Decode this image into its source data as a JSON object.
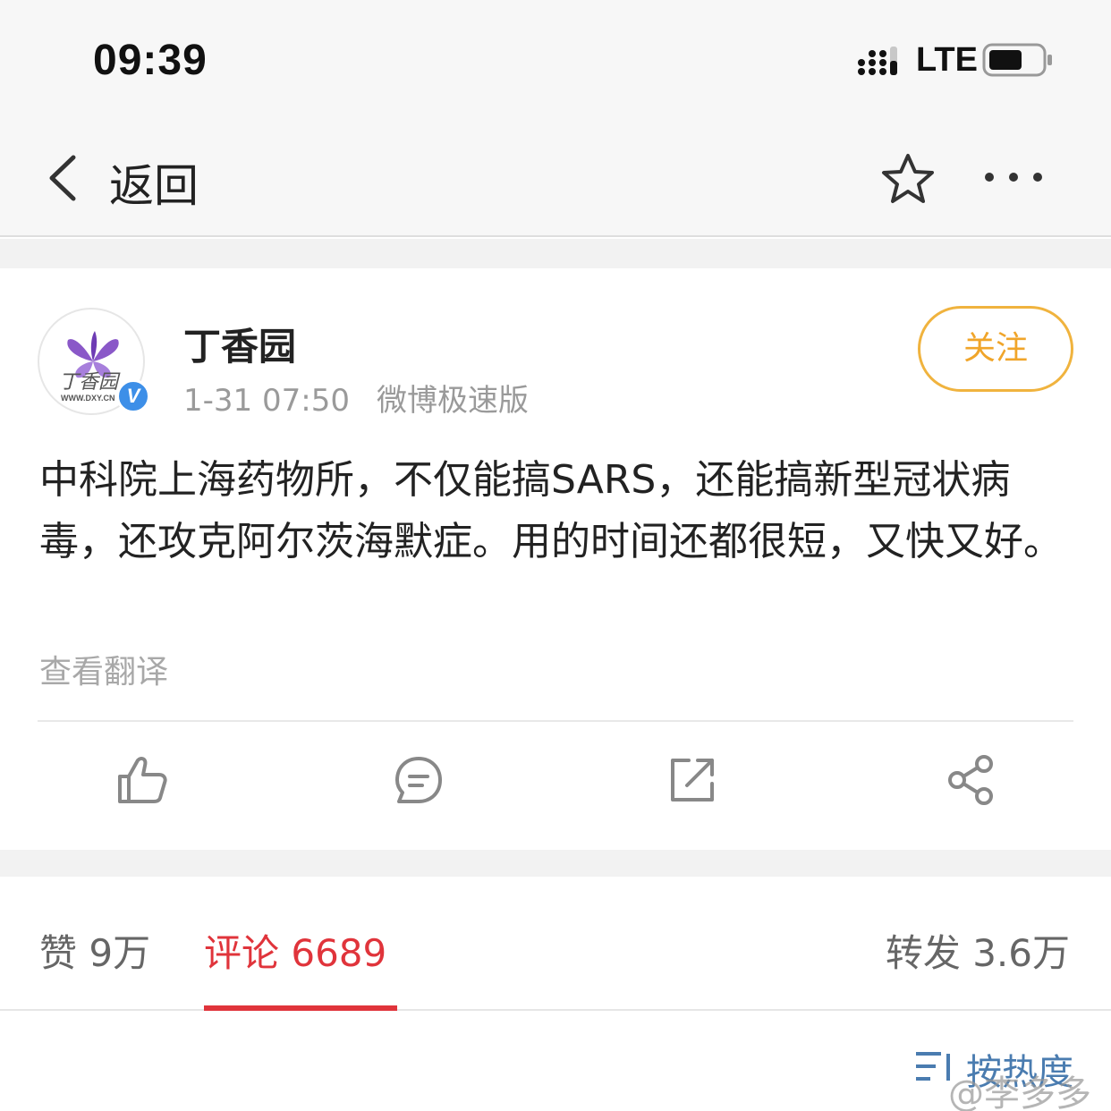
{
  "status_bar": {
    "time": "09:39",
    "network": "LTE",
    "signal_icon": "cellular-signal-icon",
    "battery_icon": "battery-icon"
  },
  "nav": {
    "back_label": "返回",
    "back_icon": "chevron-left-icon",
    "favorite_icon": "star-icon",
    "more_icon": "more-horizontal-icon"
  },
  "post": {
    "author": "丁香园",
    "avatar_text": "丁香园",
    "avatar_url_text": "WWW.DXY.CN",
    "verified_mark": "V",
    "timestamp": "1-31 07:50",
    "source": "微博极速版",
    "follow_label": "关注",
    "text": "中科院上海药物所，不仅能搞SARS，还能搞新型冠状病毒，还攻克阿尔茨海默症。用的时间还都很短，又快又好。",
    "translate_label": "查看翻译",
    "actions": [
      {
        "name": "like",
        "icon": "thumbs-up-icon"
      },
      {
        "name": "comment",
        "icon": "comment-bubble-icon"
      },
      {
        "name": "repost",
        "icon": "repost-arrow-icon"
      },
      {
        "name": "share",
        "icon": "share-nodes-icon"
      }
    ]
  },
  "tabs": {
    "likes": "赞 9万",
    "comments": "评论 6689",
    "reposts": "转发 3.6万",
    "active": "comments"
  },
  "sort": {
    "label": "按热度",
    "icon": "sort-icon"
  },
  "watermark": "@李多多",
  "colors": {
    "accent_red": "#e0343b",
    "follow_orange": "#f0a52a",
    "verified_blue": "#3d8fe8",
    "link_blue": "#4a7cb0"
  }
}
